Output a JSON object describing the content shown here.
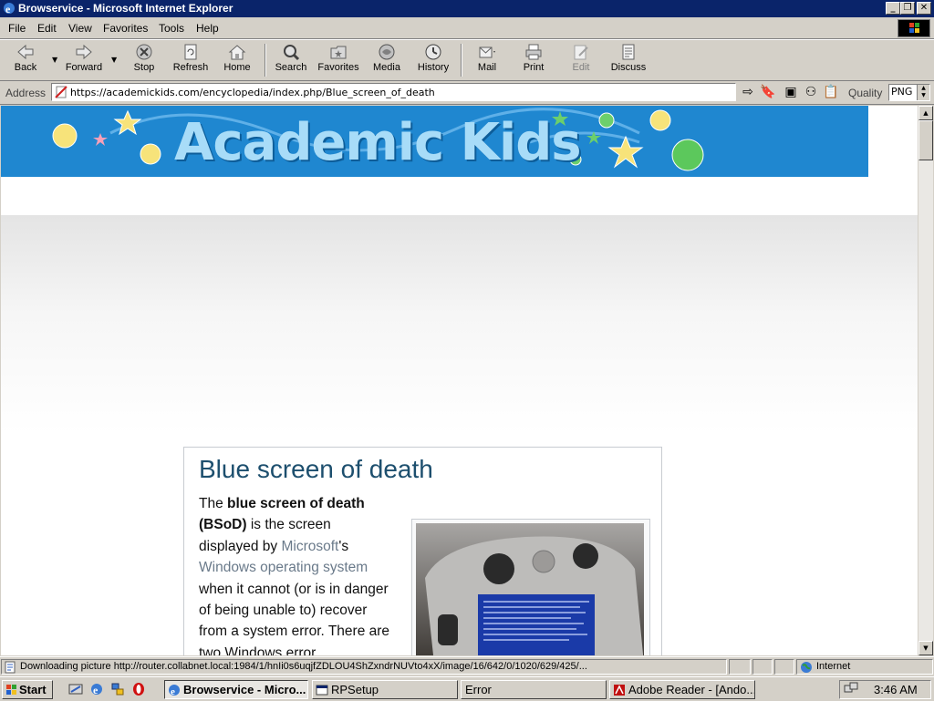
{
  "window": {
    "title": "Browservice - Microsoft Internet Explorer"
  },
  "menu": [
    "File",
    "Edit",
    "View",
    "Favorites",
    "Tools",
    "Help"
  ],
  "toolbar": {
    "back": "Back",
    "forward": "Forward",
    "stop": "Stop",
    "refresh": "Refresh",
    "home": "Home",
    "search": "Search",
    "favorites": "Favorites",
    "media": "Media",
    "history": "History",
    "mail": "Mail",
    "print": "Print",
    "edit": "Edit",
    "discuss": "Discuss"
  },
  "address": {
    "label": "Address",
    "url": "https://academickids.com/encyclopedia/index.php/Blue_screen_of_death",
    "quality_label": "Quality",
    "quality_value": "PNG"
  },
  "page": {
    "banner_logo": "Academic Kids",
    "heading": "Blue screen of death",
    "body_parts": {
      "p1": "The ",
      "bold": "blue screen of death (BSoD)",
      "p2": " is the screen displayed by ",
      "link1": "Microsoft",
      "p3": "'s ",
      "link2": "Windows operating system",
      "p4": " when it cannot (or is in danger of being unable to) recover from a system error. There are two Windows error"
    }
  },
  "status": {
    "text": "Downloading picture http://router.collabnet.local:1984/1/hnIi0s6uqjfZDLOU4ShZxndrNUVto4xX/image/16/642/0/1020/629/425/...",
    "zone": "Internet"
  },
  "taskbar": {
    "start": "Start",
    "tasks": [
      "Browservice - Micro...",
      "RPSetup",
      "Error",
      "Adobe Reader - [Ando..."
    ],
    "clock": "3:46 AM"
  },
  "icons": {
    "accent_titlebar": "#0a246a",
    "banner_color": "#1f87d0"
  }
}
